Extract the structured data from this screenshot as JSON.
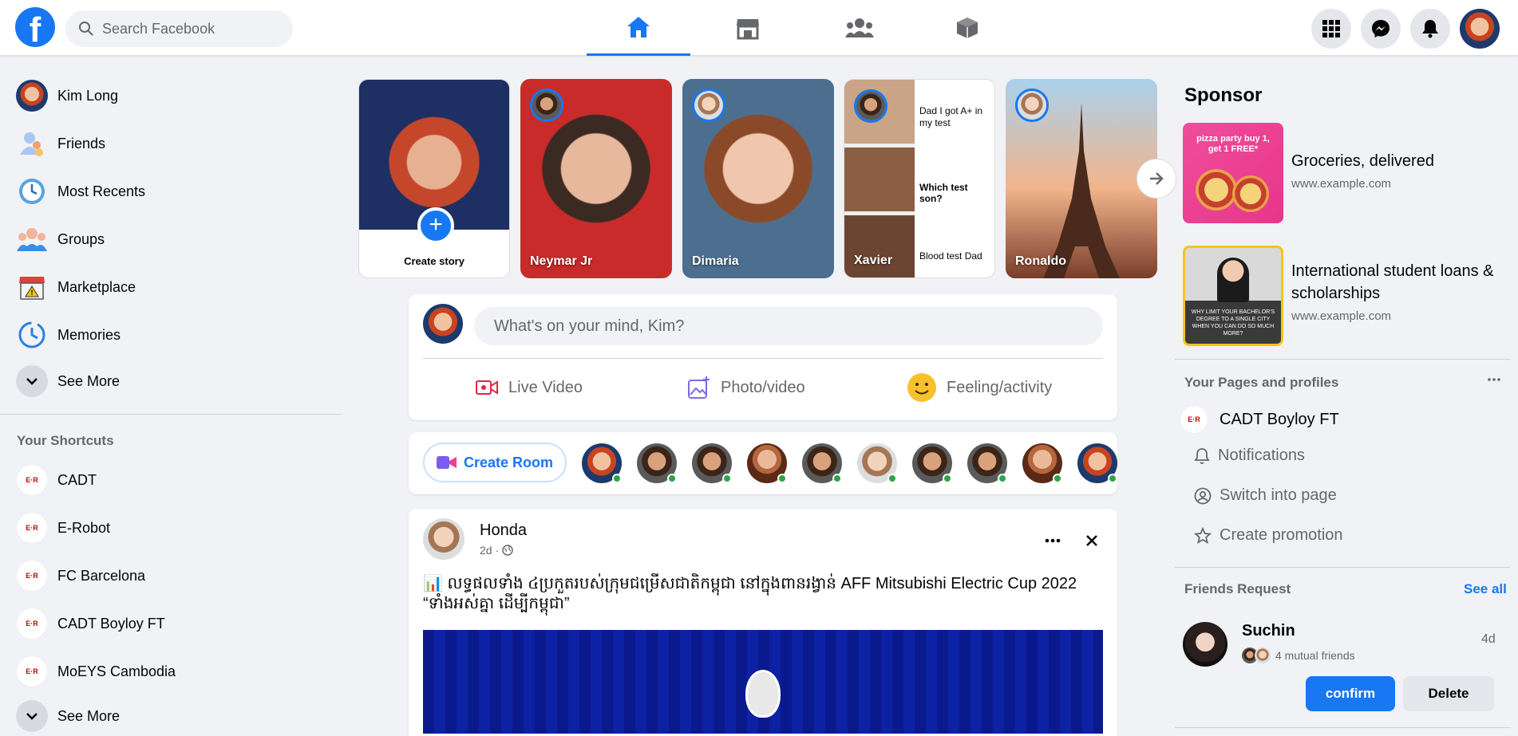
{
  "header": {
    "logo_letter": "f",
    "search_placeholder": "Search Facebook",
    "nav_tabs": [
      {
        "name": "home-icon",
        "active": true
      },
      {
        "name": "marketplace-icon",
        "active": false
      },
      {
        "name": "groups-icon",
        "active": false
      },
      {
        "name": "gaming-icon",
        "active": false
      }
    ],
    "right_buttons": [
      "menu-grid-icon",
      "messenger-icon",
      "notifications-icon",
      "account-avatar"
    ]
  },
  "sidebar": {
    "items": [
      {
        "label": "Kim Long",
        "icon": "profile-avatar"
      },
      {
        "label": "Friends",
        "icon": "friends-icon"
      },
      {
        "label": "Most Recents",
        "icon": "clock-icon"
      },
      {
        "label": "Groups",
        "icon": "groups-icon"
      },
      {
        "label": "Marketplace",
        "icon": "marketplace-icon"
      },
      {
        "label": "Memories",
        "icon": "memories-icon"
      }
    ],
    "see_more_label": "See More",
    "shortcuts_title": "Your Shortcuts",
    "shortcuts": [
      {
        "label": "CADT"
      },
      {
        "label": "E-Robot"
      },
      {
        "label": "FC Barcelona"
      },
      {
        "label": "CADT Boyloy FT"
      },
      {
        "label": "MoEYS Cambodia"
      }
    ],
    "shortcuts_see_more_label": "See More"
  },
  "stories": {
    "create_label": "Create story",
    "items": [
      {
        "name": "Neymar Jr"
      },
      {
        "name": "Dimaria"
      },
      {
        "name": "Xavier",
        "texts": [
          "Dad I got A+ in my test",
          "Which test son?",
          "Blood test Dad"
        ]
      },
      {
        "name": "Ronaldo"
      }
    ]
  },
  "composer": {
    "placeholder": "What's on your mind, Kim?",
    "actions": [
      {
        "label": "Live Video",
        "icon": "live-video-icon"
      },
      {
        "label": "Photo/video",
        "icon": "photo-video-icon"
      },
      {
        "label": "Feeling/activity",
        "icon": "feeling-icon"
      }
    ]
  },
  "rooms": {
    "create_room_label": "Create Room",
    "online_count": 10
  },
  "post": {
    "author": "Honda",
    "time": "2d ·",
    "text": "📊 លទ្ធផលទាំង ៤ប្រកួតរបស់ក្រុមជម្រើសជាតិកម្ពុជា នៅក្នុងពានរង្វាន់ AFF Mitsubishi Electric Cup 2022 “ទាំងអស់គ្នា ដើម្បីកម្ពុជា”"
  },
  "right": {
    "sponsor_title": "Sponsor",
    "ads": [
      {
        "title": "Groceries, delivered",
        "url": "www.example.com",
        "image_text": "pizza party buy 1, get 1 FREE*"
      },
      {
        "title": "International student loans & scholarships",
        "url": "www.example.com",
        "image_text": "WHY LIMIT YOUR BACHELOR'S DEGREE TO A SINGLE CITY WHEN YOU CAN DO SO MUCH MORE?"
      }
    ],
    "pages_title": "Your Pages and profiles",
    "page_name": "CADT Boyloy FT",
    "page_actions": [
      {
        "label": "Notifications",
        "icon": "bell-outline-icon"
      },
      {
        "label": "Switch into page",
        "icon": "switch-profile-icon"
      },
      {
        "label": "Create promotion",
        "icon": "star-outline-icon"
      }
    ],
    "friend_requests_title": "Friends Request",
    "see_all_label": "See all",
    "request": {
      "name": "Suchin",
      "mutual": "4 mutual friends",
      "time": "4d",
      "confirm_label": "confirm",
      "delete_label": "Delete"
    }
  },
  "colors": {
    "brand": "#1877f2",
    "online": "#31a24c",
    "background": "#f0f2f5"
  }
}
